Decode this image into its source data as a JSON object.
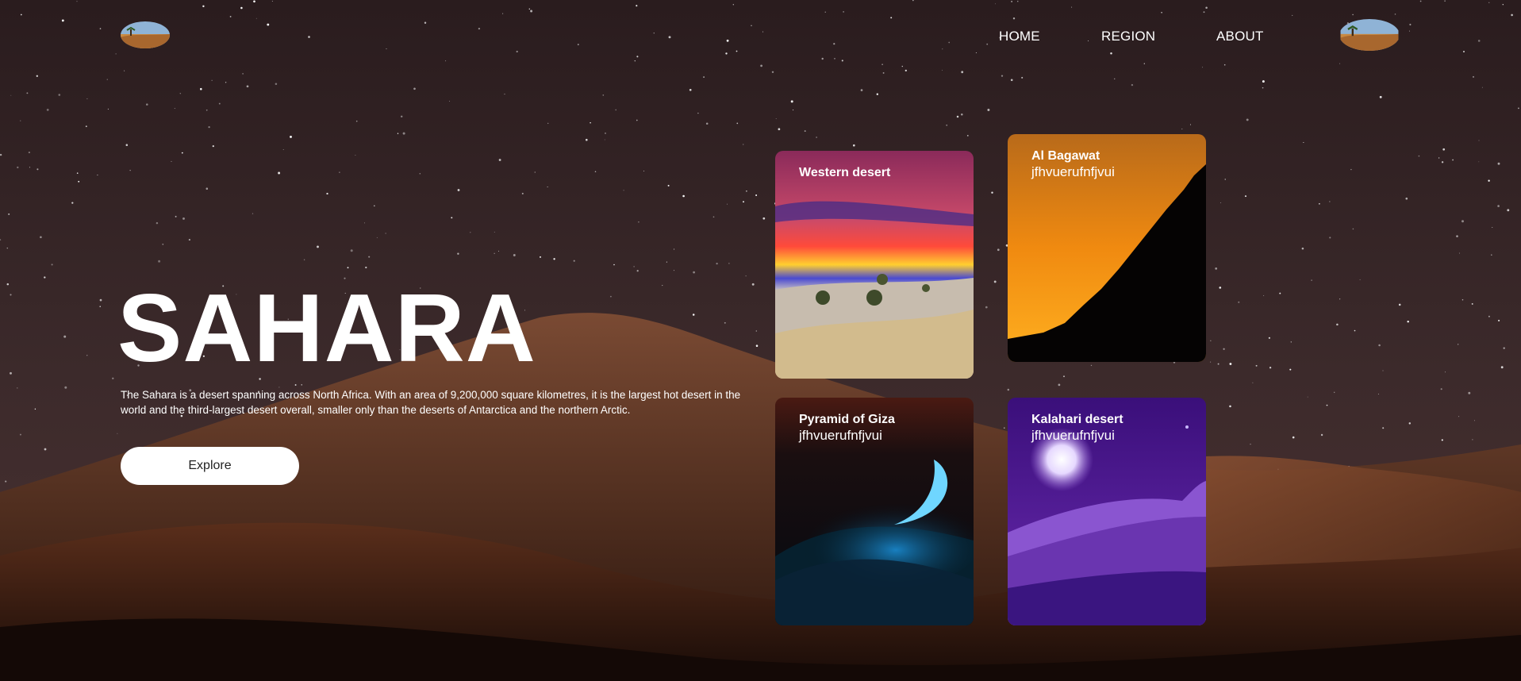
{
  "nav": {
    "links": [
      {
        "label": "HOME"
      },
      {
        "label": "REGION"
      },
      {
        "label": "ABOUT"
      }
    ]
  },
  "hero": {
    "title": "SAHARA",
    "description": "The Sahara is a desert spanning across North Africa. With an area of 9,200,000 square kilometres, it is the largest hot desert in the world and the third-largest desert overall, smaller only than the deserts of Antarctica and the northern Arctic.",
    "explore_label": "Explore"
  },
  "cards": [
    {
      "title": "Western desert",
      "subtitle": ""
    },
    {
      "title": "Al Bagawat",
      "subtitle": "jfhvuerufnfjvui"
    },
    {
      "title": "Pyramid of Giza",
      "subtitle": "jfhvuerufnfjvui"
    },
    {
      "title": "Kalahari desert",
      "subtitle": "jfhvuerufnfjvui"
    }
  ]
}
